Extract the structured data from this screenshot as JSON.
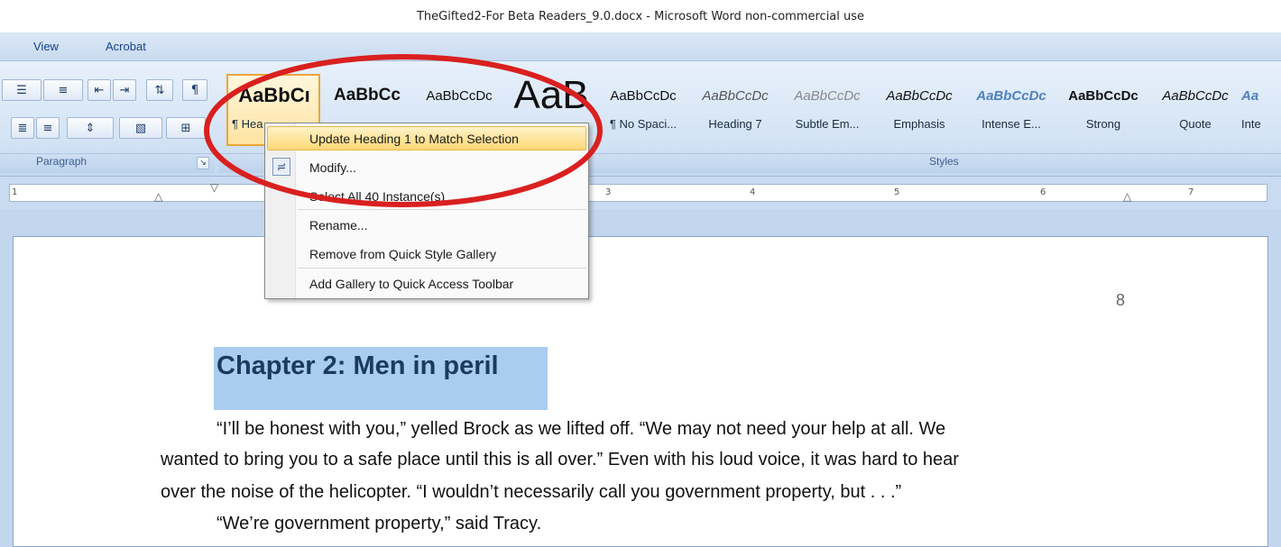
{
  "window": {
    "title": "TheGifted2-For Beta Readers_9.0.docx - Microsoft Word non-commercial use"
  },
  "tabs": [
    {
      "label": "View"
    },
    {
      "label": "Acrobat"
    }
  ],
  "ribbon": {
    "groups": {
      "paragraph": "Paragraph",
      "styles": "Styles"
    },
    "paragraph_tools": {
      "bullets": "☰",
      "multilevel": "≡",
      "decrease_indent": "⇤",
      "increase_indent": "⇥",
      "sort": "⇅",
      "show_marks": "¶",
      "align_right": "≣",
      "justify": "≡",
      "line_spacing": "⇕",
      "shading": "▧",
      "borders": "⊞"
    },
    "styles": [
      {
        "sample": "AaBbCı",
        "name": "¶ Hea"
      },
      {
        "sample": "AaBbCc",
        "name": ""
      },
      {
        "sample": "AaBbCcDc",
        "name": ""
      },
      {
        "sample": "AaB",
        "name": ""
      },
      {
        "sample": "AaBbCcDc",
        "name": "¶ No Spaci..."
      },
      {
        "sample": "AaBbCcDc",
        "name": "Heading 7"
      },
      {
        "sample": "AaBbCcDc",
        "name": "Subtle Em..."
      },
      {
        "sample": "AaBbCcDc",
        "name": "Emphasis"
      },
      {
        "sample": "AaBbCcDc",
        "name": "Intense E..."
      },
      {
        "sample": "AaBbCcDc",
        "name": "Strong"
      },
      {
        "sample": "AaBbCcDc",
        "name": "Quote"
      },
      {
        "sample": "Aa",
        "name": "Inte"
      }
    ]
  },
  "ruler": {
    "marks": [
      "1",
      "3",
      "4",
      "5",
      "6",
      "7"
    ]
  },
  "context_menu": {
    "items": [
      {
        "label": "Update Heading 1 to Match Selection"
      },
      {
        "label": "Modify..."
      },
      {
        "label": "Select All 40 Instance(s)"
      },
      {
        "label": "Rename..."
      },
      {
        "label": "Remove from Quick Style Gallery"
      },
      {
        "label": "Add Gallery to Quick Access Toolbar"
      }
    ]
  },
  "document": {
    "page_number": "8",
    "heading": "Chapter 2: Men in peril",
    "lines": [
      "“I’ll be honest with you,” yelled Brock as we lifted off. “We may not need your help at all. We",
      "wanted to bring you to a safe place until this is all over.” Even with his loud voice, it was hard to hear",
      "over the noise of the helicopter. “I wouldn’t necessarily call you government property, but . . .”",
      "“We’re government property,” said Tracy."
    ]
  },
  "colors": {
    "annotation_circle": "#d9201f",
    "selection_highlight": "#a8cdee",
    "heading_text": "#1b3a5f"
  }
}
